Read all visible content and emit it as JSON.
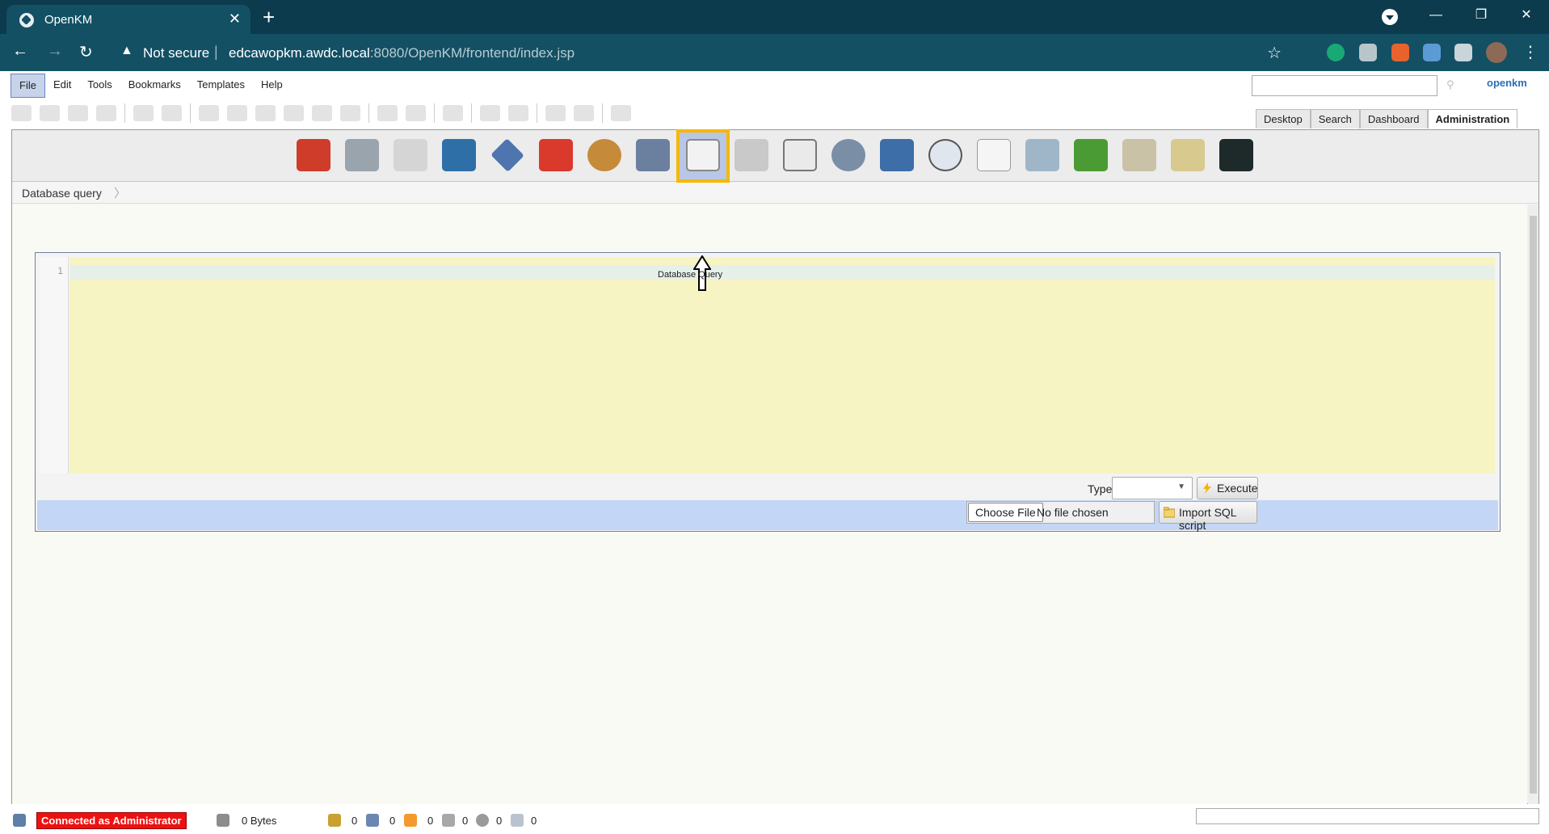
{
  "browser": {
    "tab_title": "OpenKM",
    "tab_close": "✕",
    "new_tab": "+",
    "security_label": "Not secure",
    "url_host": "edcawopkm.awdc.local",
    "url_path": ":8080/OpenKM/frontend/index.jsp",
    "win_min": "—",
    "win_restore": "❐",
    "win_close": "✕"
  },
  "menu": {
    "items": [
      "File",
      "Edit",
      "Tools",
      "Bookmarks",
      "Templates",
      "Help"
    ]
  },
  "logo": "openkm",
  "view_tabs": [
    "Desktop",
    "Search",
    "Dashboard",
    "Administration"
  ],
  "admin": {
    "selected_tool_tooltip": "Database Query",
    "breadcrumb": "Database query",
    "editor_line_number": "1",
    "type_label": "Type",
    "execute_label": "Execute",
    "choose_file_label": "Choose File",
    "no_file_label": "No file chosen",
    "import_label": "Import SQL script"
  },
  "status": {
    "connected": "Connected as Administrator",
    "size": "0 Bytes",
    "counts": [
      "0",
      "0",
      "0",
      "0",
      "0",
      "0"
    ]
  },
  "colors": {
    "chrome_dark": "#0b3b4c",
    "chrome_bar": "#135064",
    "editor_bg": "#f6f4c3",
    "highlight": "#f5b800",
    "import_row": "#c4d6f6",
    "connected_bg": "#ee1111"
  }
}
